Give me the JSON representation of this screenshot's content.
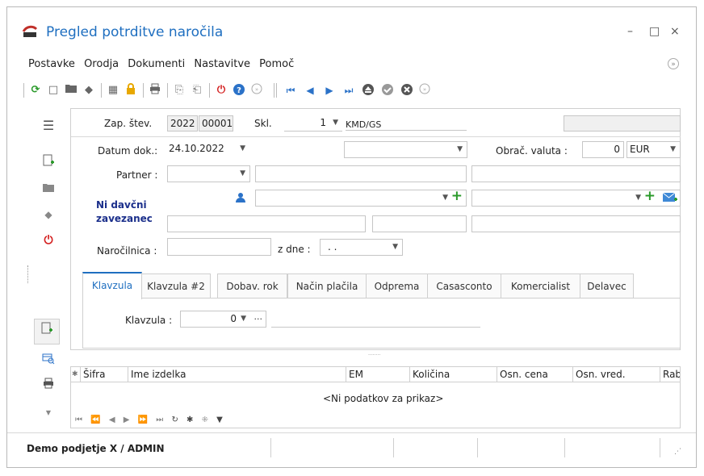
{
  "window": {
    "title": "Pregled potrditve naročila",
    "minimize": "–",
    "maximize": "□",
    "close": "×"
  },
  "menu": {
    "items": [
      "Postavke",
      "Orodja",
      "Dokumenti",
      "Nastavitve",
      "Pomoč"
    ]
  },
  "toolbar": {
    "icons": [
      "refresh-icon",
      "new-icon",
      "folder-icon",
      "erase-icon",
      "calculator-icon",
      "lock-icon",
      "print-icon",
      "copy-icon",
      "paste-icon",
      "power-icon",
      "help-icon",
      "expand-icon",
      "first-icon",
      "prev-icon",
      "next-icon",
      "last-icon",
      "eject-icon",
      "confirm-icon",
      "cancel-icon",
      "expand2-icon"
    ]
  },
  "header": {
    "zap_label": "Zap. štev.",
    "zap_year": "2022",
    "zap_num": "00001",
    "skl_label": "Skl.",
    "skl_value": "1",
    "skl_name": "KMD/GS"
  },
  "form": {
    "datum_label": "Datum dok.:",
    "datum_value": "24.10.2022",
    "obrac_label": "Obrač. valuta :",
    "obrac_value": "0",
    "currency": "EUR",
    "partner_label": "Partner :",
    "ni_davcni": "Ni davčni",
    "zavezanec": "zavezanec",
    "narocilnica_label": "Naročilnica :",
    "z_dne_label": "z dne :",
    "z_dne_value": ". ."
  },
  "tabs": [
    "Klavzula",
    "Klavzula #2",
    "Dobav. rok",
    "Način plačila",
    "Odprema",
    "Casasconto",
    "Komercialist",
    "Delavec"
  ],
  "klavzula": {
    "label": "Klavzula :",
    "value": "0",
    "ellipsis": "···"
  },
  "grid": {
    "columns": [
      "Šifra",
      "Ime izdelka",
      "EM",
      "Količina",
      "Osn. cena",
      "Osn. vred.",
      "Rab"
    ],
    "empty_text": "<Ni podatkov za prikaz>",
    "splitter": "········"
  },
  "status": {
    "company": "Demo podjetje X / ADMIN"
  },
  "colors": {
    "accent": "#1f6fc0",
    "green": "#2a9a2a",
    "red": "#d42020",
    "navy": "#1b2f8b"
  }
}
